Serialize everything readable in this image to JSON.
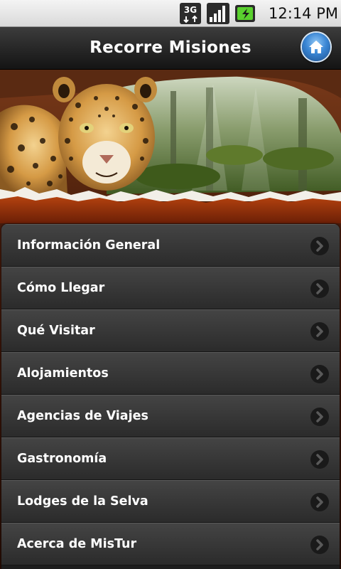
{
  "status_bar": {
    "time": "12:14 PM",
    "network_type": "3G",
    "icons": [
      "network-3g-icon",
      "signal-strength-icon",
      "battery-charging-icon"
    ]
  },
  "header": {
    "title": "Recorre Misiones",
    "home_icon": "home-icon"
  },
  "banner": {
    "image": "jaguar-jungle-banner"
  },
  "menu": {
    "items": [
      {
        "label": "Información General"
      },
      {
        "label": "Cómo Llegar"
      },
      {
        "label": "Qué Visitar"
      },
      {
        "label": "Alojamientos"
      },
      {
        "label": "Agencias de Viajes"
      },
      {
        "label": "Gastronomía"
      },
      {
        "label": "Lodges de la Selva"
      },
      {
        "label": "Acerca de MisTur"
      }
    ],
    "chevron_icon": "chevron-right-icon"
  },
  "colors": {
    "title_bar": "#1e1e1e",
    "menu_background": "#333333",
    "banner_red": "#a8360c",
    "home_button_blue": "#3a86d4"
  }
}
